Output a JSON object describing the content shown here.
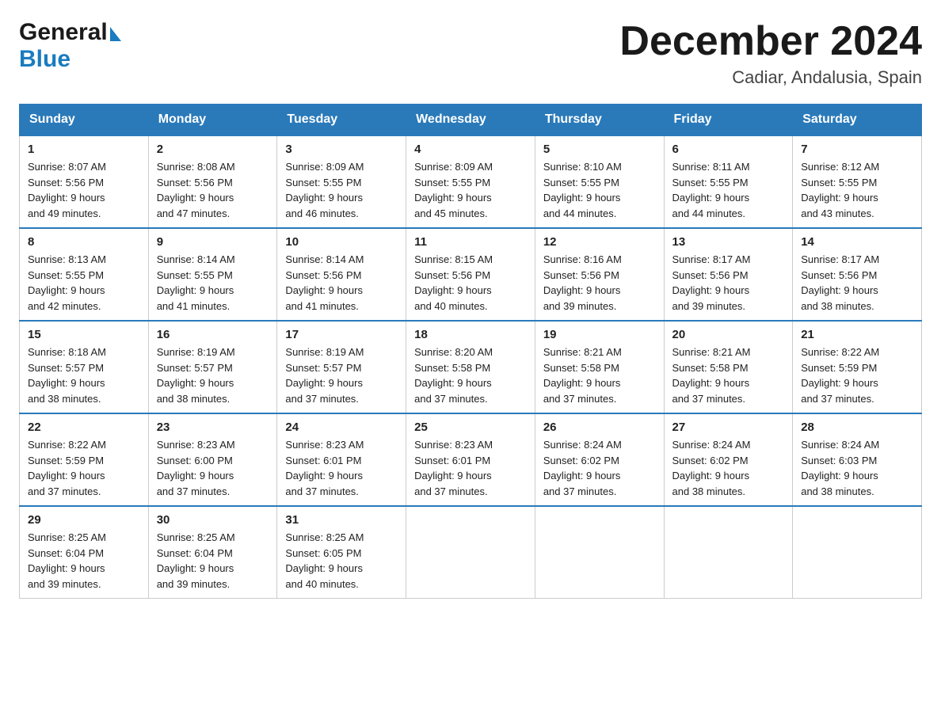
{
  "header": {
    "logo_general": "General",
    "logo_blue": "Blue",
    "month_title": "December 2024",
    "location": "Cadiar, Andalusia, Spain"
  },
  "days_of_week": [
    "Sunday",
    "Monday",
    "Tuesday",
    "Wednesday",
    "Thursday",
    "Friday",
    "Saturday"
  ],
  "weeks": [
    [
      {
        "day": "1",
        "sunrise": "8:07 AM",
        "sunset": "5:56 PM",
        "daylight": "9 hours and 49 minutes."
      },
      {
        "day": "2",
        "sunrise": "8:08 AM",
        "sunset": "5:56 PM",
        "daylight": "9 hours and 47 minutes."
      },
      {
        "day": "3",
        "sunrise": "8:09 AM",
        "sunset": "5:55 PM",
        "daylight": "9 hours and 46 minutes."
      },
      {
        "day": "4",
        "sunrise": "8:09 AM",
        "sunset": "5:55 PM",
        "daylight": "9 hours and 45 minutes."
      },
      {
        "day": "5",
        "sunrise": "8:10 AM",
        "sunset": "5:55 PM",
        "daylight": "9 hours and 44 minutes."
      },
      {
        "day": "6",
        "sunrise": "8:11 AM",
        "sunset": "5:55 PM",
        "daylight": "9 hours and 44 minutes."
      },
      {
        "day": "7",
        "sunrise": "8:12 AM",
        "sunset": "5:55 PM",
        "daylight": "9 hours and 43 minutes."
      }
    ],
    [
      {
        "day": "8",
        "sunrise": "8:13 AM",
        "sunset": "5:55 PM",
        "daylight": "9 hours and 42 minutes."
      },
      {
        "day": "9",
        "sunrise": "8:14 AM",
        "sunset": "5:55 PM",
        "daylight": "9 hours and 41 minutes."
      },
      {
        "day": "10",
        "sunrise": "8:14 AM",
        "sunset": "5:56 PM",
        "daylight": "9 hours and 41 minutes."
      },
      {
        "day": "11",
        "sunrise": "8:15 AM",
        "sunset": "5:56 PM",
        "daylight": "9 hours and 40 minutes."
      },
      {
        "day": "12",
        "sunrise": "8:16 AM",
        "sunset": "5:56 PM",
        "daylight": "9 hours and 39 minutes."
      },
      {
        "day": "13",
        "sunrise": "8:17 AM",
        "sunset": "5:56 PM",
        "daylight": "9 hours and 39 minutes."
      },
      {
        "day": "14",
        "sunrise": "8:17 AM",
        "sunset": "5:56 PM",
        "daylight": "9 hours and 38 minutes."
      }
    ],
    [
      {
        "day": "15",
        "sunrise": "8:18 AM",
        "sunset": "5:57 PM",
        "daylight": "9 hours and 38 minutes."
      },
      {
        "day": "16",
        "sunrise": "8:19 AM",
        "sunset": "5:57 PM",
        "daylight": "9 hours and 38 minutes."
      },
      {
        "day": "17",
        "sunrise": "8:19 AM",
        "sunset": "5:57 PM",
        "daylight": "9 hours and 37 minutes."
      },
      {
        "day": "18",
        "sunrise": "8:20 AM",
        "sunset": "5:58 PM",
        "daylight": "9 hours and 37 minutes."
      },
      {
        "day": "19",
        "sunrise": "8:21 AM",
        "sunset": "5:58 PM",
        "daylight": "9 hours and 37 minutes."
      },
      {
        "day": "20",
        "sunrise": "8:21 AM",
        "sunset": "5:58 PM",
        "daylight": "9 hours and 37 minutes."
      },
      {
        "day": "21",
        "sunrise": "8:22 AM",
        "sunset": "5:59 PM",
        "daylight": "9 hours and 37 minutes."
      }
    ],
    [
      {
        "day": "22",
        "sunrise": "8:22 AM",
        "sunset": "5:59 PM",
        "daylight": "9 hours and 37 minutes."
      },
      {
        "day": "23",
        "sunrise": "8:23 AM",
        "sunset": "6:00 PM",
        "daylight": "9 hours and 37 minutes."
      },
      {
        "day": "24",
        "sunrise": "8:23 AM",
        "sunset": "6:01 PM",
        "daylight": "9 hours and 37 minutes."
      },
      {
        "day": "25",
        "sunrise": "8:23 AM",
        "sunset": "6:01 PM",
        "daylight": "9 hours and 37 minutes."
      },
      {
        "day": "26",
        "sunrise": "8:24 AM",
        "sunset": "6:02 PM",
        "daylight": "9 hours and 37 minutes."
      },
      {
        "day": "27",
        "sunrise": "8:24 AM",
        "sunset": "6:02 PM",
        "daylight": "9 hours and 38 minutes."
      },
      {
        "day": "28",
        "sunrise": "8:24 AM",
        "sunset": "6:03 PM",
        "daylight": "9 hours and 38 minutes."
      }
    ],
    [
      {
        "day": "29",
        "sunrise": "8:25 AM",
        "sunset": "6:04 PM",
        "daylight": "9 hours and 39 minutes."
      },
      {
        "day": "30",
        "sunrise": "8:25 AM",
        "sunset": "6:04 PM",
        "daylight": "9 hours and 39 minutes."
      },
      {
        "day": "31",
        "sunrise": "8:25 AM",
        "sunset": "6:05 PM",
        "daylight": "9 hours and 40 minutes."
      },
      null,
      null,
      null,
      null
    ]
  ]
}
